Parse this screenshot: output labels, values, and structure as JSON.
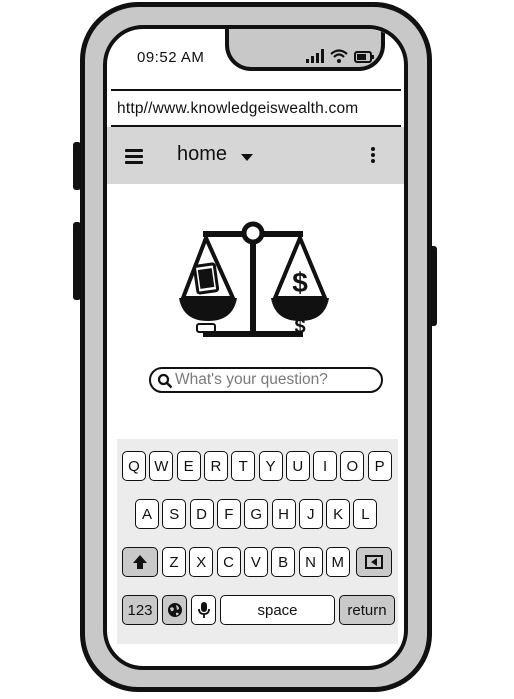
{
  "status_bar": {
    "time": "09:52 AM"
  },
  "browser": {
    "url": "http//www.knowledgeiswealth.com"
  },
  "nav": {
    "title": "home"
  },
  "search": {
    "placeholder": "What's your question?"
  },
  "keyboard": {
    "row1": [
      "Q",
      "W",
      "E",
      "R",
      "T",
      "Y",
      "U",
      "I",
      "O",
      "P"
    ],
    "row2": [
      "A",
      "S",
      "D",
      "F",
      "G",
      "H",
      "J",
      "K",
      "L"
    ],
    "row3": [
      "Z",
      "X",
      "C",
      "V",
      "B",
      "N",
      "M"
    ],
    "numbers_label": "123",
    "space_label": "space",
    "return_label": "return"
  },
  "logo": {
    "coin_symbol": "$"
  },
  "colors": {
    "frame": "#c8c8c8",
    "outline": "#111111",
    "nav_bg": "#d6d6d6",
    "keyboard_bg": "#ececec",
    "dark_key": "#c9c9c9"
  }
}
